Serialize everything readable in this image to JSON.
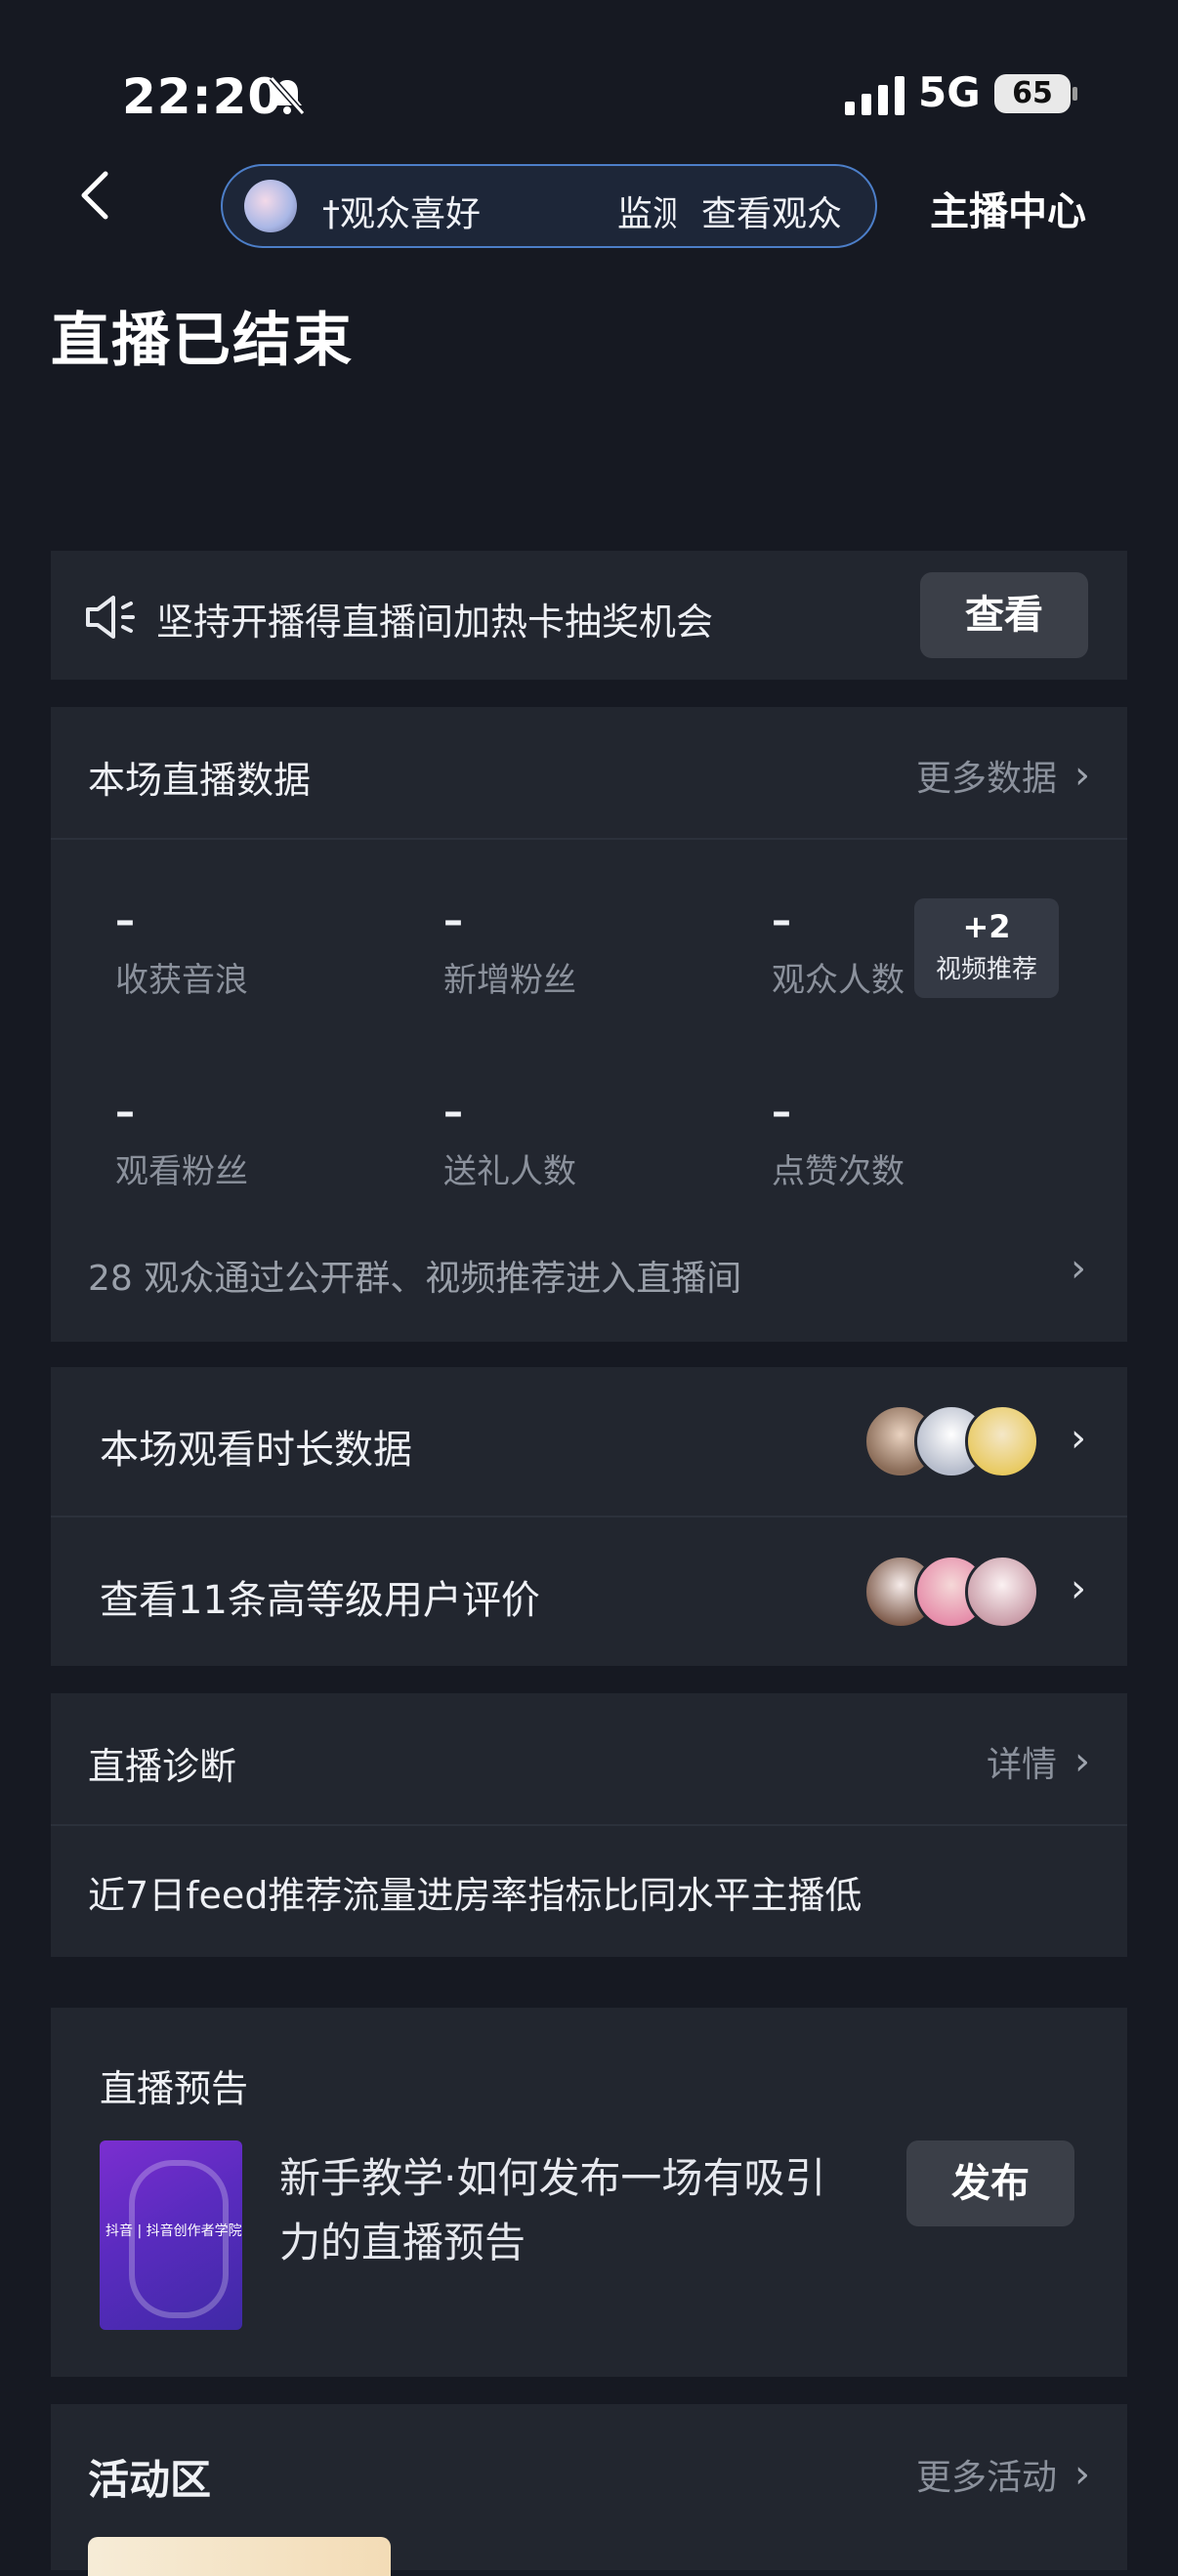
{
  "status_bar": {
    "time": "22:20",
    "network": "5G",
    "battery": "65"
  },
  "nav": {
    "pill_text_left": "†观众喜好",
    "pill_text_mid": "监测",
    "pill_text_right": "查看观众",
    "anchor_center": "主播中心"
  },
  "page_title": "直播已结束",
  "notice": {
    "text": "坚持开播得直播间加热卡抽奖机会",
    "button": "查看"
  },
  "live_data": {
    "title": "本场直播数据",
    "more_link": "更多数据",
    "stats": [
      {
        "value": "–",
        "label": "收获音浪"
      },
      {
        "value": "–",
        "label": "新增粉丝"
      },
      {
        "value": "–",
        "label": "观众人数"
      },
      {
        "value": "–",
        "label": "观看粉丝"
      },
      {
        "value": "–",
        "label": "送礼人数"
      },
      {
        "value": "–",
        "label": "点赞次数"
      }
    ],
    "badge": {
      "count": "+2",
      "label": "视频推荐"
    },
    "source_line": "28 观众通过公开群、视频推荐进入直播间"
  },
  "rows": [
    {
      "label": "本场观看时长数据"
    },
    {
      "label": "查看11条高等级用户评价"
    }
  ],
  "diagnosis": {
    "title": "直播诊断",
    "link": "详情",
    "content": "近7日feed推荐流量进房率指标比同水平主播低"
  },
  "preview": {
    "title": "直播预告",
    "text": "新手教学·如何发布一场有吸引力的直播预告",
    "button": "发布",
    "thumb_caption": "抖音 | 抖音创作者学院"
  },
  "activity": {
    "title": "活动区",
    "link": "更多活动"
  },
  "chevron": "›"
}
